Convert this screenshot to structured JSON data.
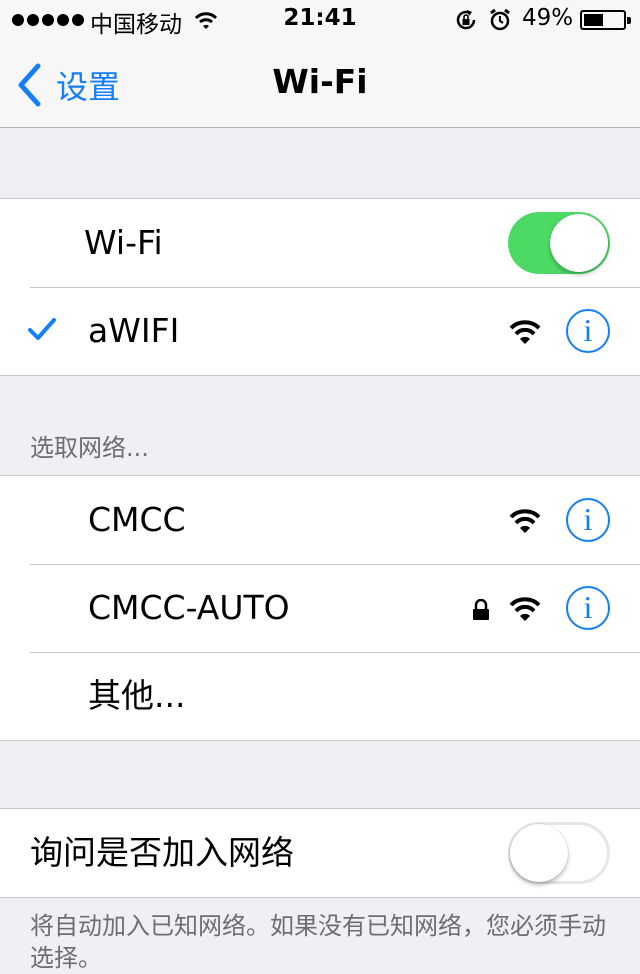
{
  "status_bar": {
    "carrier": "中国移动",
    "time": "21:41",
    "battery_percent": "49%",
    "battery_level": 0.49
  },
  "nav": {
    "back_label": "设置",
    "title": "Wi-Fi"
  },
  "wifi_section": {
    "wifi_label": "Wi-Fi",
    "wifi_enabled": true,
    "connected_network": "aWIFI"
  },
  "networks_section": {
    "header": "选取网络...",
    "networks": [
      {
        "name": "CMCC",
        "secured": false
      },
      {
        "name": "CMCC-AUTO",
        "secured": true
      }
    ],
    "other_label": "其他..."
  },
  "ask_section": {
    "label": "询问是否加入网络",
    "enabled": false,
    "footer": "将自动加入已知网络。如果没有已知网络，您必须手动选择。"
  },
  "colors": {
    "accent": "#147efb",
    "toggle_on": "#4cd964",
    "background": "#efeff4"
  },
  "icons": {
    "info": "i",
    "back": "chevron-left-icon",
    "wifi": "wifi-icon",
    "lock": "lock-icon",
    "check": "checkmark-icon"
  }
}
